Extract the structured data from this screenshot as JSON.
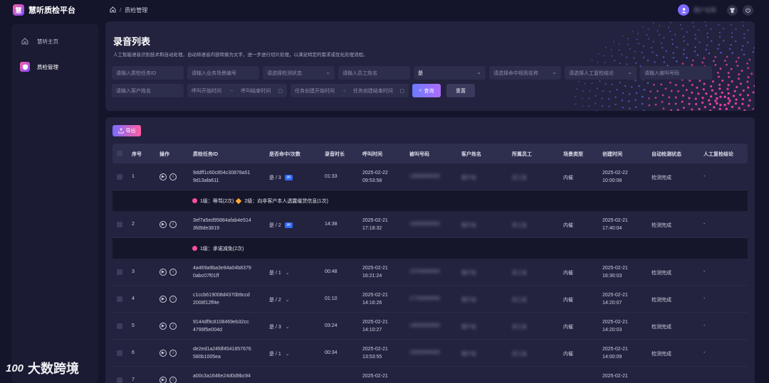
{
  "app": {
    "logo_glyph": "慧",
    "title": "慧听质检平台"
  },
  "breadcrumb": {
    "current": "质检管理"
  },
  "topbar": {
    "user_name": "用户名称"
  },
  "sidebar": {
    "items": [
      {
        "label": "慧听主页",
        "icon": "home-icon",
        "active": false
      },
      {
        "label": "质检管理",
        "icon": "shield-icon",
        "active": true
      }
    ]
  },
  "page": {
    "title": "录音列表",
    "description": "人工智能语音识别技术和自动处理，自动将语音内容转换为文字，进一步进行切片处理，以满足特定的需求或优化处理流程。"
  },
  "filters": {
    "row1": [
      {
        "placeholder": "请输入质检任务ID",
        "type": "input"
      },
      {
        "placeholder": "请输入业务场景编号",
        "type": "input"
      },
      {
        "placeholder": "请选择检测状态",
        "type": "select"
      },
      {
        "placeholder": "请输入员工姓名",
        "type": "input"
      },
      {
        "value": "是",
        "type": "select"
      },
      {
        "placeholder": "请选择命中规则名称",
        "type": "select"
      },
      {
        "placeholder": "请选择人工复检结论",
        "type": "select"
      },
      {
        "placeholder": "请输入被叫号码",
        "type": "input"
      }
    ],
    "customer_placeholder": "请输入客户姓名",
    "call_start": "呼叫开始时间",
    "call_end": "呼叫结束时间",
    "task_start": "任务创建开始时间",
    "task_end": "任务创建结束时间",
    "query_label": "查询",
    "reset_label": "重置"
  },
  "toolbar": {
    "export_label": "导出"
  },
  "table": {
    "headers": [
      "序号",
      "操作",
      "质检任务ID",
      "是否命中/次数",
      "录音时长",
      "呼叫时间",
      "被叫号码",
      "客户姓名",
      "所属员工",
      "场景类型",
      "创建时间",
      "自动检测状态",
      "人工复检结论"
    ],
    "rows": [
      {
        "no": "1",
        "id1": "9ddff1c60c854c30878a51",
        "id2": "9d13afa611",
        "hit": "是 / 3",
        "hit_tag": "AI",
        "duration": "01:33",
        "call_date": "2025-02-22",
        "call_time": "09:53:58",
        "phone": "13800000000",
        "customer": "客户名",
        "staff": "员工名",
        "scene": "内催",
        "cdate": "2025-02-22",
        "ctime": "10:00:08",
        "status": "检测完成",
        "review": "-",
        "detail": [
          {
            "level": "1级：辱骂(2次)",
            "color": "#ff4fa0"
          },
          {
            "level": "2级：向非客户本人透露催贷信息(1次)",
            "color": "#ffaa33"
          }
        ]
      },
      {
        "no": "2",
        "id1": "3ef7a5ed95884afab4e514",
        "id2": "3fd9de3819",
        "hit": "是 / 2",
        "hit_tag": "AI",
        "duration": "14:38",
        "call_date": "2025-02-21",
        "call_time": "17:18:32",
        "phone": "13900000000",
        "customer": "客户名",
        "staff": "员工名",
        "scene": "内催",
        "cdate": "2025-02-21",
        "ctime": "17:40:04",
        "status": "检测完成",
        "review": "-",
        "detail": [
          {
            "level": "1级：承诺减免(2次)",
            "color": "#ff4fa0"
          }
        ]
      },
      {
        "no": "3",
        "id1": "4a469a9ba3e84a04b8379",
        "id2": "0abc07f01ff",
        "hit": "是 / 1",
        "duration": "00:48",
        "call_date": "2025-02-21",
        "call_time": "16:21:24",
        "phone": "13700000000",
        "customer": "客户名",
        "staff": "员工名",
        "scene": "内催",
        "cdate": "2025-02-21",
        "ctime": "16:30:03",
        "status": "检测完成",
        "review": "-"
      },
      {
        "no": "4",
        "id1": "c1ccb619008d4370b9ccd",
        "id2": "2008f12ff4e",
        "hit": "是 / 2",
        "duration": "01:10",
        "call_date": "2025-02-21",
        "call_time": "14:16:26",
        "phone": "17700000000",
        "customer": "客户名",
        "staff": "员工名",
        "scene": "内催",
        "cdate": "2025-02-21",
        "ctime": "14:20:07",
        "status": "检测完成",
        "review": "-"
      },
      {
        "no": "5",
        "id1": "9144df9c8108469eb32cc",
        "id2": "4799f5e004d",
        "hit": "是 / 3",
        "duration": "03:24",
        "call_date": "2025-02-21",
        "call_time": "14:10:27",
        "phone": "13600000000",
        "customer": "客户名",
        "staff": "员工名",
        "scene": "内催",
        "cdate": "2025-02-21",
        "ctime": "14:20:03",
        "status": "检测完成",
        "review": "-"
      },
      {
        "no": "6",
        "id1": "de2ed1a24fdf4541857676",
        "id2": "580b1005ea",
        "hit": "是 / 1",
        "duration": "00:34",
        "call_date": "2025-02-21",
        "call_time": "13:53:55",
        "phone": "13500000000",
        "customer": "客户名",
        "staff": "员工名",
        "scene": "内催",
        "cdate": "2025-02-21",
        "ctime": "14:00:09",
        "status": "检测完成",
        "review": "-"
      },
      {
        "no": "7",
        "id1": "a00c3a1646e24d0d9bc94",
        "id2": "",
        "hit": "",
        "duration": "",
        "call_date": "2025-02-21",
        "call_time": "",
        "phone": "",
        "customer": "",
        "staff": "",
        "scene": "",
        "cdate": "2025-02-21",
        "ctime": "",
        "status": "",
        "review": ""
      }
    ]
  },
  "watermark": {
    "logo": "100",
    "text": "大数跨境"
  },
  "colors": {
    "bg": "#14142b",
    "panel": "#23233f",
    "accent_pink": "#ff5fa2",
    "accent_purple": "#7b4dff",
    "tag_blue": "#2f6bff"
  }
}
